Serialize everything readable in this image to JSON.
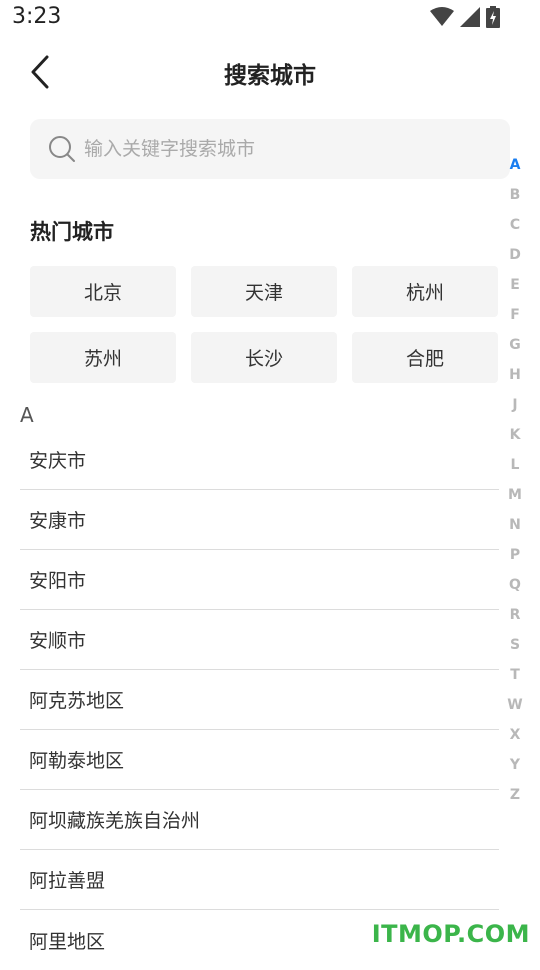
{
  "status_bar": {
    "time": "3:23",
    "icons": [
      "wifi-icon",
      "signal-icon",
      "battery-icon"
    ]
  },
  "header": {
    "back_icon": "back-arrow-icon",
    "title": "搜索城市"
  },
  "search": {
    "icon": "search-icon",
    "placeholder": "输入关键字搜索城市",
    "value": ""
  },
  "hot": {
    "title": "热门城市",
    "cities": [
      "北京",
      "天津",
      "杭州",
      "苏州",
      "长沙",
      "合肥"
    ]
  },
  "section": {
    "letter": "A",
    "cities": [
      "安庆市",
      "安康市",
      "安阳市",
      "安顺市",
      "阿克苏地区",
      "阿勒泰地区",
      "阿坝藏族羌族自治州",
      "阿拉善盟",
      "阿里地区"
    ]
  },
  "index": {
    "letters": [
      "A",
      "B",
      "C",
      "D",
      "E",
      "F",
      "G",
      "H",
      "J",
      "K",
      "L",
      "M",
      "N",
      "P",
      "Q",
      "R",
      "S",
      "T",
      "W",
      "X",
      "Y",
      "Z"
    ],
    "active": "A"
  },
  "watermark": "ITMOP.COM",
  "colors": {
    "accent": "#1a7ef0",
    "index_inactive": "#b8b8b8",
    "watermark": "#3bb54a",
    "chip_bg": "#f4f4f4"
  }
}
